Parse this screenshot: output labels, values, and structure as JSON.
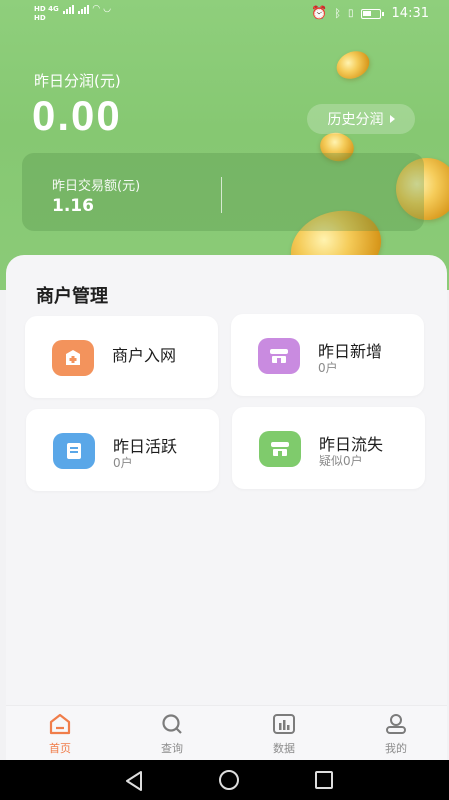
{
  "status_bar": {
    "time": "14:31",
    "left_row1": "HD 4G",
    "left_row2": "HD"
  },
  "header": {
    "profit_label": "昨日分润(元)",
    "profit_value": "0.00",
    "history_button": "历史分润",
    "trade_label": "昨日交易额(元)",
    "trade_value": "1.16"
  },
  "merchant": {
    "section_title": "商户管理",
    "tiles": [
      {
        "title": "商户入网",
        "subtitle": "",
        "icon": "add-shop-icon",
        "color": "#f3935c"
      },
      {
        "title": "昨日新增",
        "subtitle": "0户",
        "icon": "store-icon",
        "color": "#c98be0"
      },
      {
        "title": "昨日活跃",
        "subtitle": "0户",
        "icon": "list-doc-icon",
        "color": "#5aa7e8"
      },
      {
        "title": "昨日流失",
        "subtitle": "疑似0户",
        "icon": "store-icon",
        "color": "#7fcb6c"
      }
    ]
  },
  "bottom_nav": {
    "items": [
      {
        "label": "首页",
        "icon": "home-icon",
        "active": true
      },
      {
        "label": "查询",
        "icon": "search-icon",
        "active": false
      },
      {
        "label": "数据",
        "icon": "bar-chart-icon",
        "active": false
      },
      {
        "label": "我的",
        "icon": "user-icon",
        "active": false
      }
    ]
  },
  "colors": {
    "accent": "#f07d4a",
    "header_green": "#8bcb78"
  }
}
